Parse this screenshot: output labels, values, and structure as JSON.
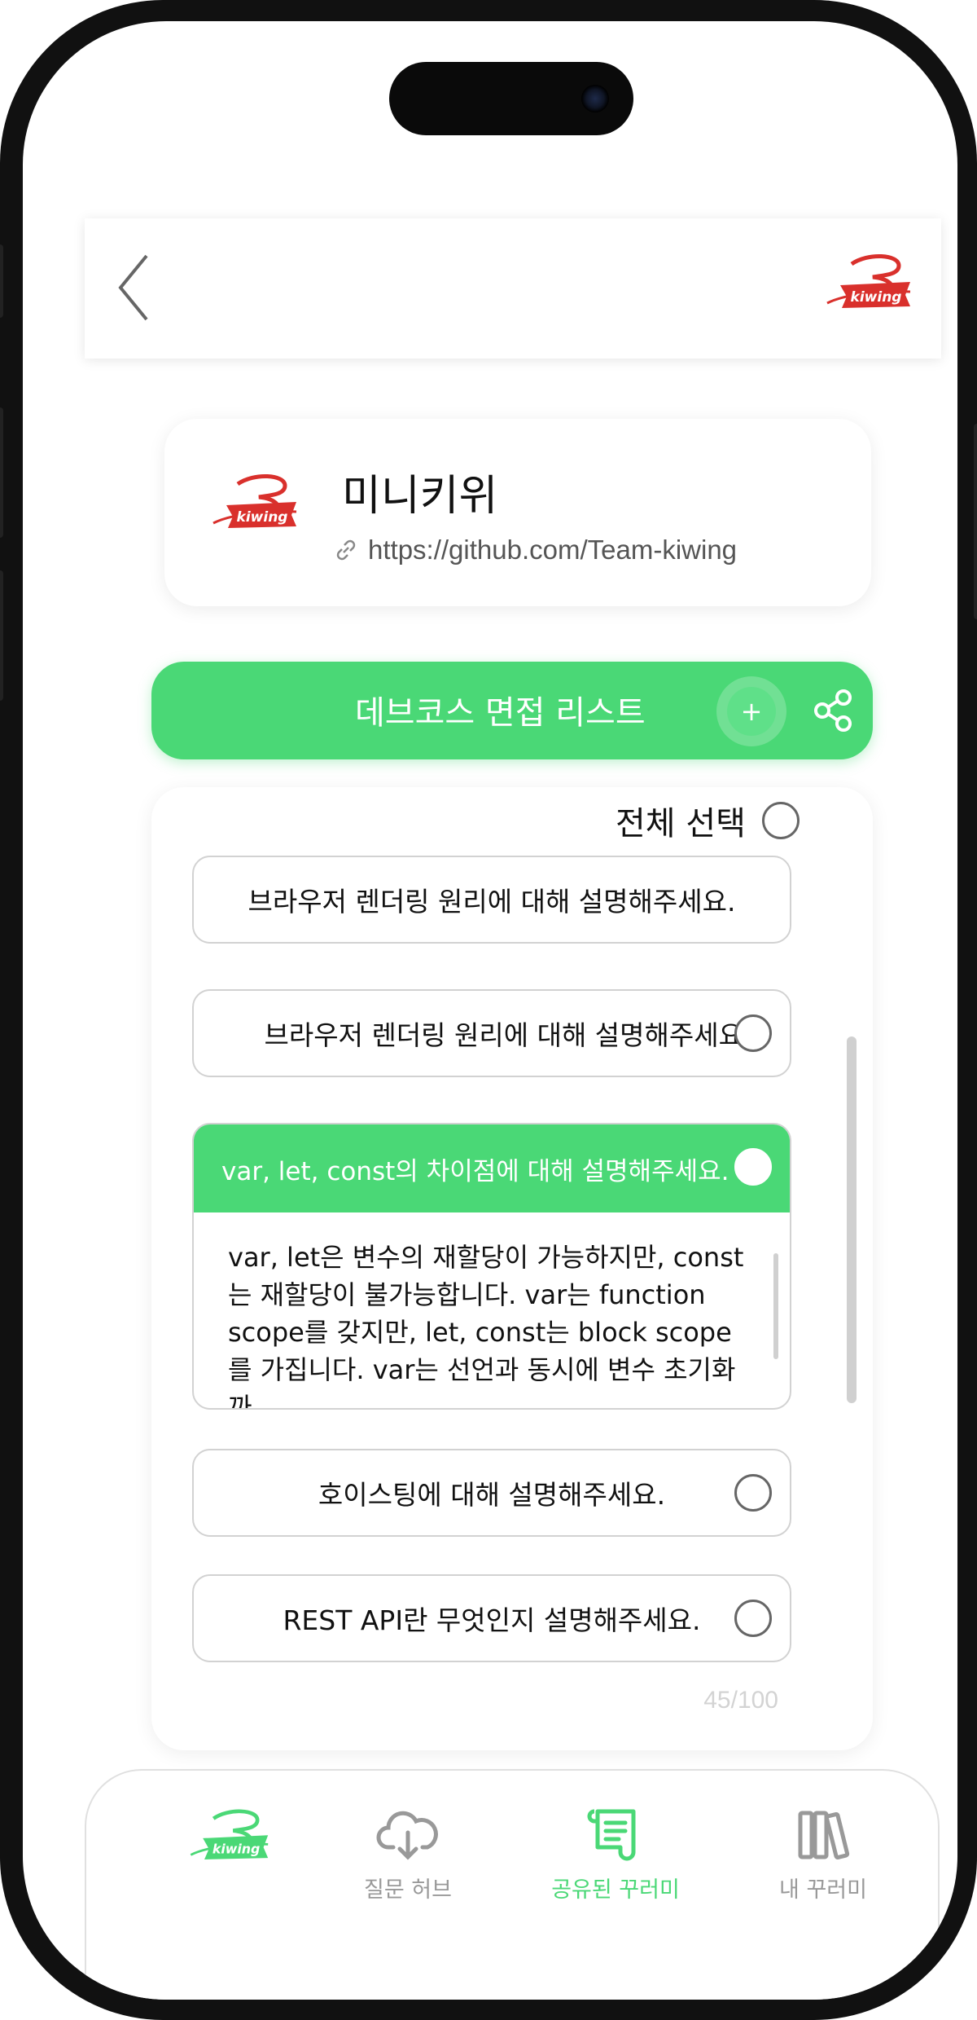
{
  "header": {
    "logo_text": "kiwing"
  },
  "profile": {
    "name": "미니키위",
    "link": "https://github.com/Team-kiwing"
  },
  "list": {
    "title": "데브코스 면접 리스트",
    "add_symbol": "+"
  },
  "questions": {
    "select_all_label": "전체 선택",
    "items": [
      {
        "text": "브라우저 렌더링 원리에 대해 설명해주세요."
      },
      {
        "text": "브라우저 렌더링 원리에 대해 설명해주세요."
      },
      {
        "text": "var, let, const의 차이점에 대해 설명해주세요.",
        "answer": "var, let은 변수의 재할당이 가능하지만, const는 재할당이 불가능합니다. var는 function scope를 갖지만, let, const는 block scope를 가집니다. var는 선언과 동시에 변수 초기화까"
      },
      {
        "text": "호이스팅에 대해 설명해주세요."
      },
      {
        "text": "REST API란 무엇인지 설명해주세요."
      }
    ],
    "counter": "45/100"
  },
  "nav": {
    "items": [
      {
        "label": ""
      },
      {
        "label": "질문 허브"
      },
      {
        "label": "공유된 꾸러미"
      },
      {
        "label": "내 꾸러미"
      }
    ],
    "active_color": "#4ad876",
    "inactive_color": "#999999"
  },
  "colors": {
    "accent": "#4ad876",
    "brand_red": "#d9302c"
  }
}
